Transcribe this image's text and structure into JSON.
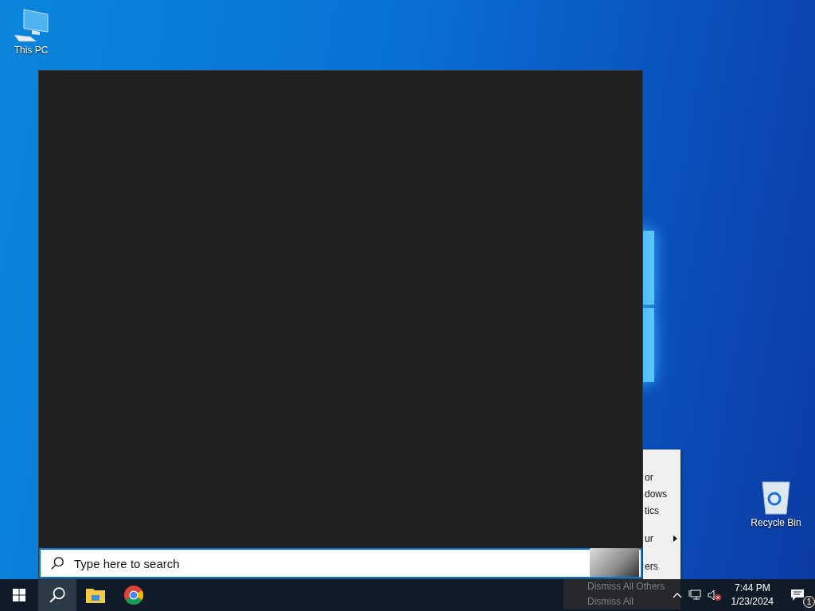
{
  "desktop_icons": [
    {
      "kind": "computer",
      "label": "This PC"
    },
    {
      "kind": "recycle_bin",
      "label": "Recycle Bin"
    }
  ],
  "search_panel": {
    "placeholder": "Type here to search"
  },
  "context_menu": {
    "items": [
      {
        "label": "or",
        "has_submenu": false
      },
      {
        "label": "dows",
        "has_submenu": false
      },
      {
        "label": "tics",
        "has_submenu": false
      },
      {
        "label": "ur",
        "has_submenu": true
      },
      {
        "label": "ers",
        "has_submenu": false
      }
    ],
    "lower_items": [
      {
        "label": "Dismiss All Others"
      },
      {
        "label": "Dismiss All"
      }
    ]
  },
  "taskbar": {
    "buttons": [
      {
        "kind": "start",
        "selected": false
      },
      {
        "kind": "search",
        "selected": true
      },
      {
        "kind": "files",
        "selected": false
      },
      {
        "kind": "browser",
        "selected": false
      }
    ],
    "tray": {
      "sound_muted": true,
      "time": "7:44 PM",
      "date": "1/23/2024",
      "notification_count": "1"
    }
  }
}
